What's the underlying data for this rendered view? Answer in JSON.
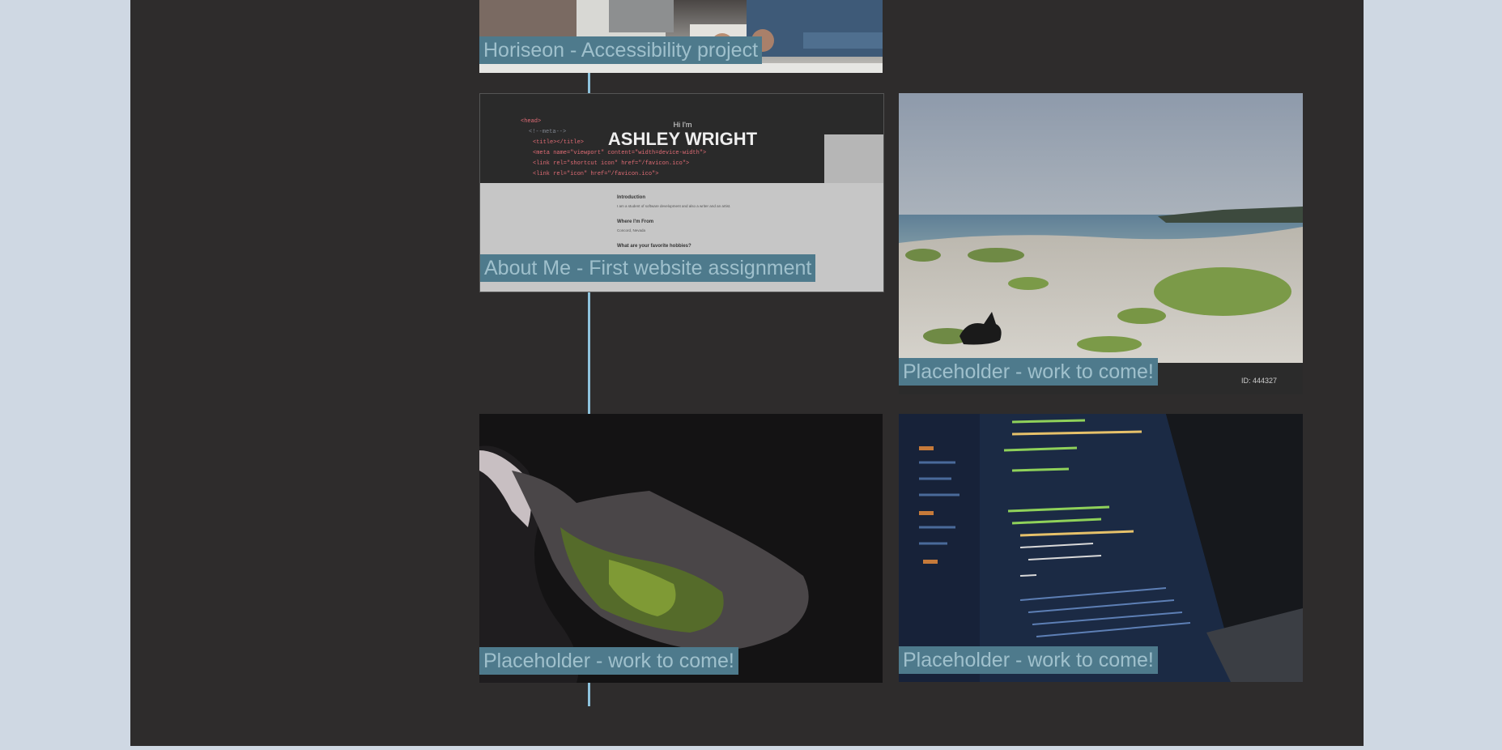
{
  "portfolio": {
    "projects": [
      {
        "caption": "Horiseon - Accessibility project",
        "image": "meeting-table-photo"
      },
      {
        "caption": "About Me - First website assignment",
        "image": "ashley-wright-site-screenshot"
      },
      {
        "caption": "Placeholder - work to come!",
        "image": "beach-dog-photo"
      },
      {
        "caption": "Placeholder - work to come!",
        "image": "cave-photo"
      },
      {
        "caption": "Placeholder - work to come!",
        "image": "code-laptop-photo"
      }
    ]
  },
  "about_me_shot": {
    "greeting": "Hi I'm",
    "name": "ASHLEY WRIGHT",
    "sections": [
      "Introduction",
      "Where I'm From",
      "What are your favorite hobbies?"
    ],
    "intro_text": "I am a student of software development and also a writer and an artist.",
    "from_text": "Concord, Nevada"
  },
  "beach_shot": {
    "id_label": "ID: 444327"
  },
  "colors": {
    "page_bg": "#cfd8e3",
    "panel_bg": "#2e2c2c",
    "accent_line": "#8ec3dc",
    "caption_bg": "#4e7a8c",
    "caption_text": "#9fc0cc"
  }
}
